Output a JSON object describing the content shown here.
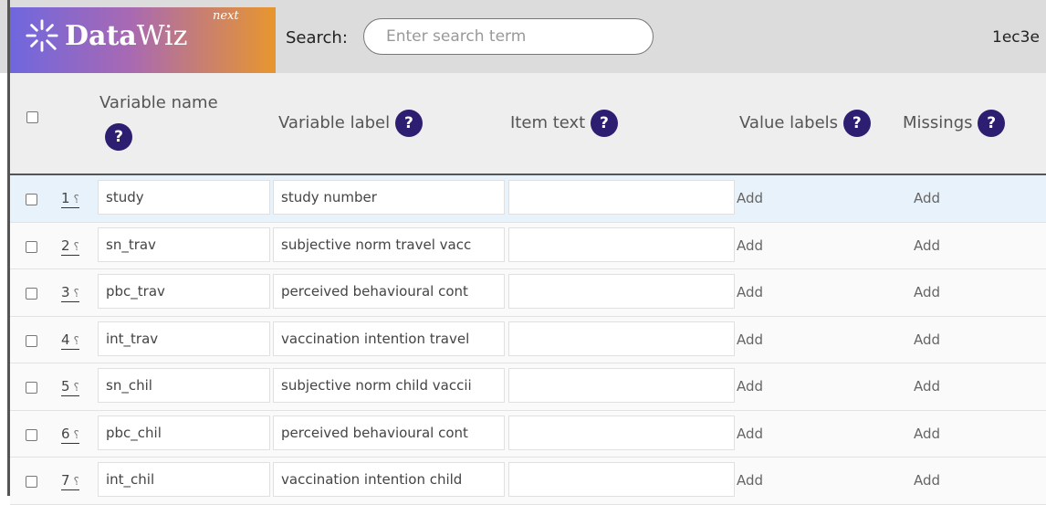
{
  "app": {
    "logo_name_bold": "Data",
    "logo_name_rest": "Wiz",
    "logo_next": "next"
  },
  "search": {
    "label": "Search:",
    "placeholder": "Enter search term"
  },
  "id_text": "1ec3e",
  "table": {
    "headers": {
      "name": "Variable name",
      "label": "Variable label",
      "item": "Item text",
      "values": "Value labels",
      "missings": "Missings",
      "help": "?"
    },
    "rows": [
      {
        "num": "1",
        "name": "study",
        "label": "study number",
        "item": "",
        "values": "Add",
        "missings": "Add"
      },
      {
        "num": "2",
        "name": "sn_trav",
        "label": "subjective norm travel vacc",
        "item": "",
        "values": "Add",
        "missings": "Add"
      },
      {
        "num": "3",
        "name": "pbc_trav",
        "label": "perceived behavioural cont",
        "item": "",
        "values": "Add",
        "missings": "Add"
      },
      {
        "num": "4",
        "name": "int_trav",
        "label": "vaccination intention travel",
        "item": "",
        "values": "Add",
        "missings": "Add"
      },
      {
        "num": "5",
        "name": "sn_chil",
        "label": "subjective norm child vaccii",
        "item": "",
        "values": "Add",
        "missings": "Add"
      },
      {
        "num": "6",
        "name": "pbc_chil",
        "label": "perceived behavioural cont",
        "item": "",
        "values": "Add",
        "missings": "Add"
      },
      {
        "num": "7",
        "name": "int_chil",
        "label": "vaccination intention child",
        "item": "",
        "values": "Add",
        "missings": "Add"
      }
    ]
  },
  "colors": {
    "help_badge": "#2d1e72",
    "logo_gradient_start": "#6f67de",
    "logo_gradient_end": "#e8962e",
    "selected_row": "#e8f2fb"
  }
}
